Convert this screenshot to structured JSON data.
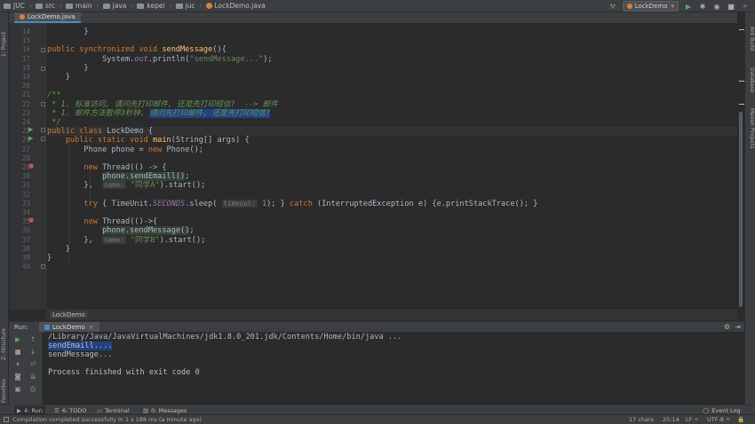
{
  "navbar": {
    "crumbs": [
      {
        "label": "JUC",
        "icon": "folder-icon"
      },
      {
        "label": "src",
        "icon": "folder-icon"
      },
      {
        "label": "main",
        "icon": "folder-icon"
      },
      {
        "label": "java",
        "icon": "folder-icon"
      },
      {
        "label": "kepei",
        "icon": "folder-icon"
      },
      {
        "label": "juc",
        "icon": "folder-icon"
      },
      {
        "label": "LockDemo.java",
        "icon": "java-class-icon"
      }
    ],
    "run_config": "LockDemo"
  },
  "editor_tab": {
    "label": "LockDemo.java"
  },
  "left_strip": {
    "project": "1: Project",
    "structure": "Z: Structure",
    "favorites": "2: Favorites"
  },
  "right_strip": {
    "ant": "Ant Build",
    "database": "Database",
    "maven": "Maven Projects"
  },
  "gutter": {
    "lines": [
      "14",
      "15",
      "16",
      "17",
      "18",
      "19",
      "20",
      "21",
      "22",
      "23",
      "24",
      "25",
      "26",
      "27",
      "28",
      "29",
      "30",
      "31",
      "32",
      "33",
      "34",
      "35",
      "36",
      "37",
      "38",
      "39",
      "40"
    ]
  },
  "code": {
    "l14_a": "        }",
    "l16_kw": "public synchronized void ",
    "l16_fn": "sendMessage",
    "l16_rest": "(){",
    "l17_a": "            System.",
    "l17_out": "out",
    "l17_b": ".println(",
    "l17_s": "\"sendMessage...\"",
    "l17_c": ");",
    "l18": "        }",
    "l19": "    }",
    "l21": "/**",
    "l22": " * 1. 标准访问, 请问先打印邮件, 还是先打印短信?  --> 邮件",
    "l23_a": " * 1. 邮件方法暂停3秒钟, ",
    "l23_sel": "请问先打印邮件, 还是先打印短信?",
    "l24": " */",
    "l25_kw": "public class ",
    "l25_rest": "LockDemo {",
    "l26_kw": "    public static void ",
    "l26_fn": "main",
    "l26_rest": "(String[] args) {",
    "l27_a": "        Phone phone = ",
    "l27_kw": "new ",
    "l27_b": "Phone();",
    "l29_kw": "        new ",
    "l29_rest": "Thread(() -> {",
    "l30_pad": "            ",
    "l30_obj": "phone",
    "l30_call": ".sendEmaill()",
    "l30_end": ";",
    "l31_a": "        },  ",
    "l31_hint": "name:",
    "l31_s": " \"同学A\"",
    "l31_b": ").start();",
    "l33_kw": "        try ",
    "l33_a": "{ TimeUnit.",
    "l33_sec": "SECONDS",
    "l33_b": ".sleep( ",
    "l33_hint": "timeout:",
    "l33_n": " 1",
    "l33_c": "); } ",
    "l33_kw2": "catch ",
    "l33_d": "(InterruptedException e) {e.printStackTrace(); }",
    "l35_kw": "        new ",
    "l35_rest": "Thread(()->{",
    "l36_pad": "            ",
    "l36_obj": "phone",
    "l36_call": ".sendMessage()",
    "l36_end": ";",
    "l37_a": "        },  ",
    "l37_hint": "name:",
    "l37_s": " \"同学B\"",
    "l37_b": ").start();",
    "l38": "    }",
    "l39": "}"
  },
  "editor_breadcrumb": "LockDemo",
  "run_panel": {
    "label": "Run:",
    "tab": "LockDemo",
    "console": [
      "/Library/Java/JavaVirtualMachines/jdk1.8.0_201.jdk/Contents/Home/bin/java ...",
      "sendEmaill....",
      "sendMessage...",
      "",
      "Process finished with exit code 0"
    ]
  },
  "bottom_tools": {
    "run": "4: Run",
    "todo": "6: TODO",
    "terminal": "Terminal",
    "messages": "0: Messages",
    "event_log": "Event Log"
  },
  "status": {
    "message": "Compilation completed successfully in 1 s 188 ms (a minute ago)",
    "chars": "17 chars",
    "position": "25:14",
    "line_sep": "LF ÷",
    "encoding": "UTF-8 ÷"
  }
}
